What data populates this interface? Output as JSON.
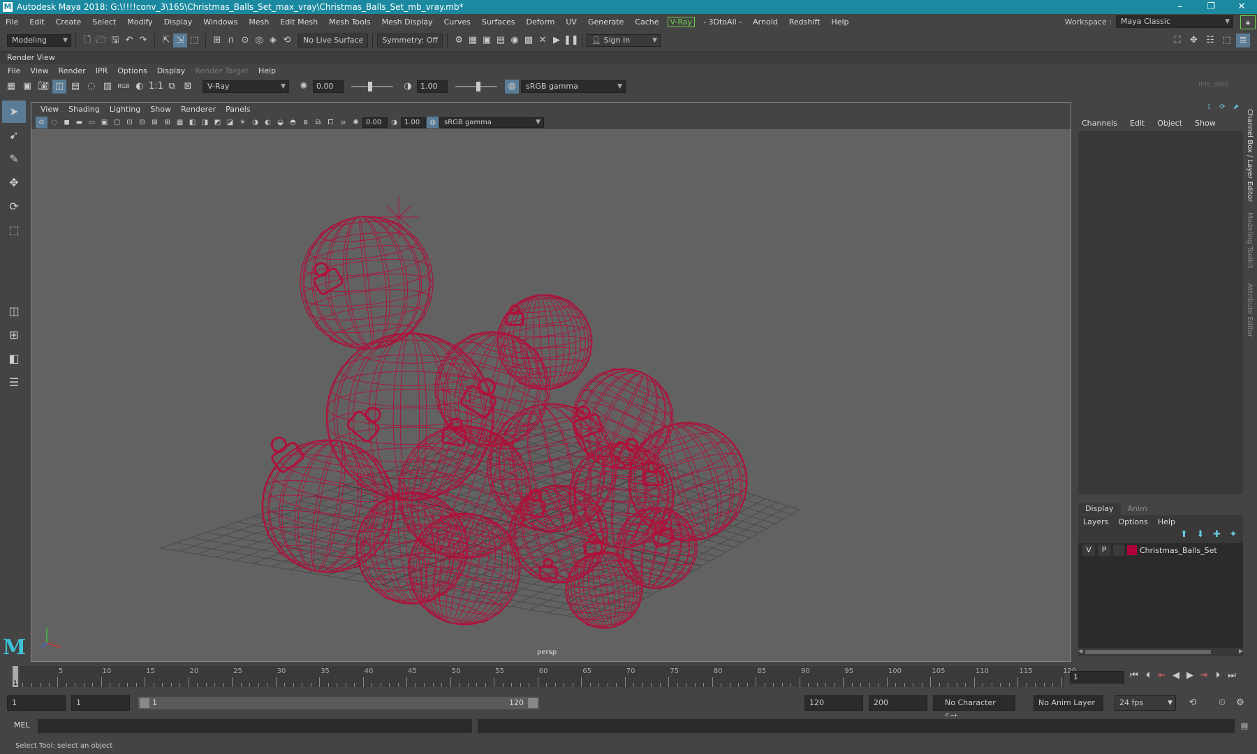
{
  "window": {
    "logo": "M",
    "title": "Autodesk Maya 2018: G:\\!!!!conv_3\\165\\Christmas_Balls_Set_max_vray\\Christmas_Balls_Set_mb_vray.mb*",
    "minimize": "–",
    "restore": "❐",
    "close": "✕"
  },
  "menubar": [
    "File",
    "Edit",
    "Create",
    "Select",
    "Modify",
    "Display",
    "Windows",
    "Mesh",
    "Edit Mesh",
    "Mesh Tools",
    "Mesh Display",
    "Curves",
    "Surfaces",
    "Deform",
    "UV",
    "Generate",
    "Cache",
    "V-Ray",
    "- 3DtoAll -",
    "Arnold",
    "Redshift",
    "Help"
  ],
  "workspace": {
    "label": "Workspace :",
    "value": "Maya Classic"
  },
  "statusline": {
    "menuset": "Modeling",
    "live_surface": "No Live Surface",
    "symmetry": "Symmetry: Off",
    "sign_in": "Sign In"
  },
  "render_view": {
    "title": "Render View",
    "menu": [
      "File",
      "View",
      "Render",
      "IPR",
      "Options",
      "Display",
      "Render Target",
      "Help"
    ],
    "ratio_label": "1:1",
    "rgb_label": "RGB",
    "renderer": "V-Ray",
    "exposure": "0.00",
    "gamma": "1.00",
    "color_space": "sRGB gamma",
    "ipr": "IPR: 0MB"
  },
  "viewport": {
    "menu": [
      "View",
      "Shading",
      "Lighting",
      "Show",
      "Renderer",
      "Panels"
    ],
    "exposure": "0.00",
    "gamma": "1.00",
    "color_space": "sRGB gamma",
    "camera": "persp",
    "wire_color": "#b0103a"
  },
  "channel_box": {
    "menu": [
      "Channels",
      "Edit",
      "Object",
      "Show"
    ]
  },
  "layer_editor": {
    "tabs": [
      "Display",
      "Anim"
    ],
    "menu": [
      "Layers",
      "Options",
      "Help"
    ],
    "layers": [
      {
        "visible": "V",
        "playback": "P",
        "color": "#b0003a",
        "name": "Christmas_Balls_Set"
      }
    ]
  },
  "side_tabs": [
    "Channel Box / Layer Editor",
    "Modeling Toolkit",
    "Attribute Editor"
  ],
  "time_slider": {
    "current_frame": "1",
    "current_frame_field": "1",
    "ticks": [
      "5",
      "10",
      "15",
      "20",
      "25",
      "30",
      "35",
      "40",
      "45",
      "50",
      "55",
      "60",
      "65",
      "70",
      "75",
      "80",
      "85",
      "90",
      "95",
      "100",
      "105",
      "110",
      "115",
      "120"
    ]
  },
  "range_slider": {
    "start": "1",
    "anim_start": "1",
    "range_start_label": "1",
    "range_end_label": "120",
    "end": "120",
    "anim_end": "200",
    "character_set": "No Character Set",
    "anim_layer": "No Anim Layer",
    "fps": "24 fps"
  },
  "command_line": {
    "lang": "MEL"
  },
  "help_line": "Select Tool: select an object"
}
